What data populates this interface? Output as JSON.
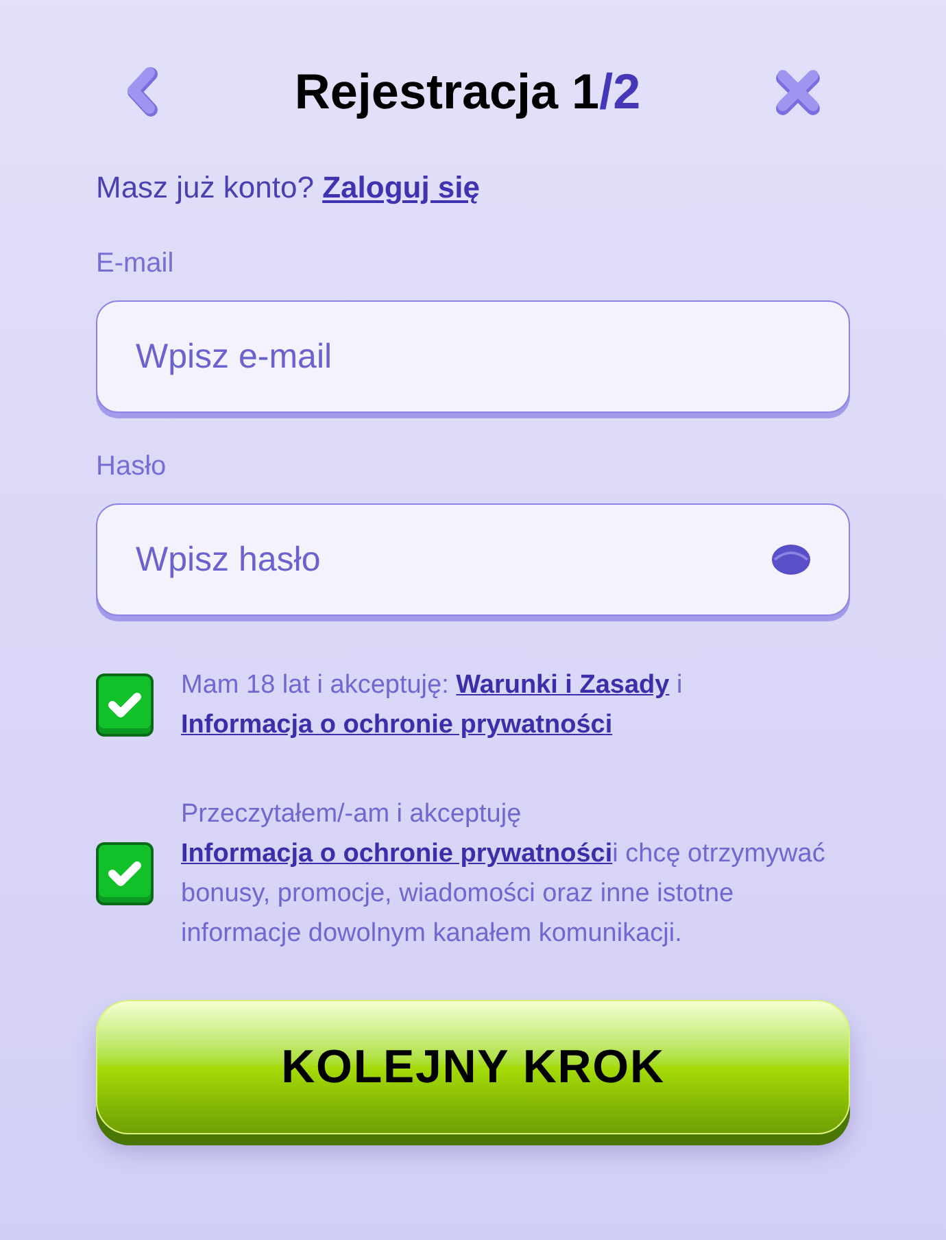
{
  "header": {
    "title": "Rejestracja 1",
    "title_step": "/2"
  },
  "login_prompt": {
    "text": "Masz już konto?",
    "link": "Zaloguj się"
  },
  "fields": [
    {
      "label": "E-mail",
      "placeholder": "Wpisz e-mail",
      "kind": "email"
    },
    {
      "label": "Hasło",
      "placeholder": "Wpisz hasło",
      "kind": "password"
    }
  ],
  "consents": [
    {
      "checked": true,
      "segments": [
        {
          "kind": "text",
          "text": "Mam 18 lat i akceptuję: "
        },
        {
          "kind": "link",
          "text": "Warunki i Zasady"
        },
        {
          "kind": "text",
          "text": " i "
        },
        {
          "kind": "link",
          "text": "Informacja o ochronie prywatności"
        }
      ]
    },
    {
      "checked": true,
      "segments": [
        {
          "kind": "text",
          "text": "Przeczytałem/-am i akceptuję "
        },
        {
          "kind": "link",
          "text": "Informacja o ochronie prywatności"
        },
        {
          "kind": "text",
          "text": "i chcę otrzymywać bonusy, promocje, wiadomości oraz inne istotne informacje dowolnym kanałem komunikacji."
        }
      ]
    }
  ],
  "submit": {
    "label": "KOLEJNY KROK"
  }
}
